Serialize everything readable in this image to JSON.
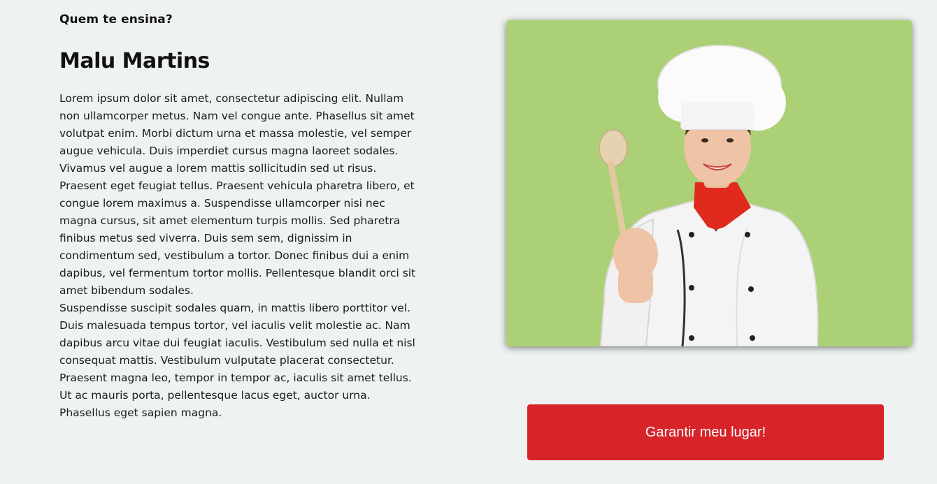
{
  "instructor": {
    "kicker": "Quem te ensina?",
    "name": "Malu Martins",
    "bio_paragraphs": [
      "Lorem ipsum dolor sit amet, consectetur adipiscing elit. Nullam non ullamcorper metus. Nam vel congue ante. Phasellus sit amet volutpat enim. Morbi dictum urna et massa molestie, vel semper augue vehicula. Duis imperdiet cursus magna laoreet sodales. Vivamus vel augue a lorem mattis sollicitudin sed ut risus. Praesent eget feugiat tellus. Praesent vehicula pharetra libero, et congue lorem maximus a. Suspendisse ullamcorper nisi nec magna cursus, sit amet elementum turpis mollis. Sed pharetra finibus metus sed viverra. Duis sem sem, dignissim in condimentum sed, vestibulum a tortor. Donec finibus dui a enim dapibus, vel fermentum tortor mollis. Pellentesque blandit orci sit amet bibendum sodales.",
      "Suspendisse suscipit sodales quam, in mattis libero porttitor vel. Duis malesuada tempus tortor, vel iaculis velit molestie ac. Nam dapibus arcu vitae dui feugiat iaculis. Vestibulum sed nulla et nisl consequat mattis. Vestibulum vulputate placerat consectetur. Praesent magna leo, tempor in tempor ac, iaculis sit amet tellus. Ut ac mauris porta, pellentesque lacus eget, auctor urna. Phasellus eget sapien magna."
    ]
  },
  "photo": {
    "background_color": "#acd075",
    "subject": "chef-with-wooden-spoon"
  },
  "cta": {
    "label": "Garantir meu lugar!",
    "color": "#d62428"
  },
  "colors": {
    "page_background": "#eef3f1"
  }
}
